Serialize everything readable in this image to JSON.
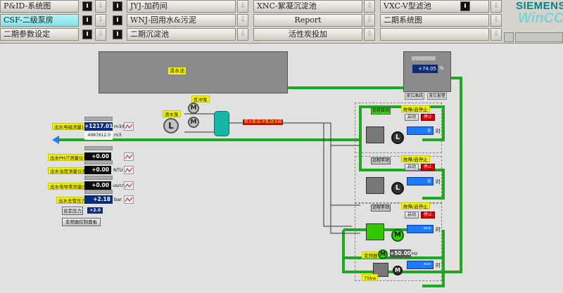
{
  "nav": {
    "row1": [
      "P&ID-系统图",
      "JYJ-加药间",
      "XNC-絮凝沉淀池",
      "VXC-V型滤池"
    ],
    "row2": [
      "CSF-二级泵房",
      "WNJ-回用水&污泥",
      "Report",
      "二期系统图"
    ],
    "row3": [
      "二期参数设定",
      "二期沉淀池",
      "活性炭投加",
      ""
    ],
    "arrow_glyph": "⇩"
  },
  "brand": {
    "line1": "SIEMENS",
    "line2": "WinCC"
  },
  "colors": {
    "pipe": "#1fa81f",
    "accent_cyan": "#7fe3e8",
    "value_bg": "#0a2a7a"
  },
  "tank": {
    "label": "清水池"
  },
  "level": {
    "value": "+74.05",
    "unit": "%",
    "btn_left": "液位曲线",
    "btn_right": "液位报警"
  },
  "center": {
    "backwash_pump": "反冲泵",
    "water_pump": "清水泵",
    "motor_label": "M",
    "motor_label_L": "L",
    "red_tag": "将水泵/反冲泵/送水阀"
  },
  "instruments": [
    {
      "label": "出水电磁流量计",
      "value": "+1217.01",
      "unit": "m3/h",
      "sub": "4987612.0",
      "sub_unit": "m3"
    },
    {
      "label": "出水PH/T测量仪表",
      "value": "+0.00",
      "unit": ""
    },
    {
      "label": "出水浊度测量仪表",
      "value": "+0.00",
      "unit": "NTU"
    },
    {
      "label": "出水电导率测量仪表",
      "value": "+0.00",
      "unit": "us/cm"
    },
    {
      "label": "出水总管压力",
      "value": "+2.18",
      "unit": "bar"
    }
  ],
  "setpoint": {
    "btn": "设定压力",
    "value": "+2.0"
  },
  "vfd_btn": "变频器控制面板",
  "pumps": [
    {
      "title": "故障/启停止",
      "mode": "远程自动",
      "run": "启动",
      "stop": "停止",
      "hours": "0",
      "hours_unit": "时",
      "motor": "L"
    },
    {
      "title": "故障/启停止",
      "mode": "远程手动",
      "run": "启动",
      "stop": "停止",
      "hours": "0",
      "hours_unit": "时",
      "motor": "L"
    },
    {
      "title": "故障/启停止",
      "mode": "远程手动",
      "run": "启动",
      "stop": "停止",
      "hours": "***",
      "hours_unit": "时",
      "motor": "M"
    }
  ],
  "vfd": {
    "label": "变频器",
    "freq": "+50.00",
    "unit": "Hz",
    "power": "75kw",
    "motor": "M",
    "hours": "***",
    "hours_unit": "时"
  }
}
